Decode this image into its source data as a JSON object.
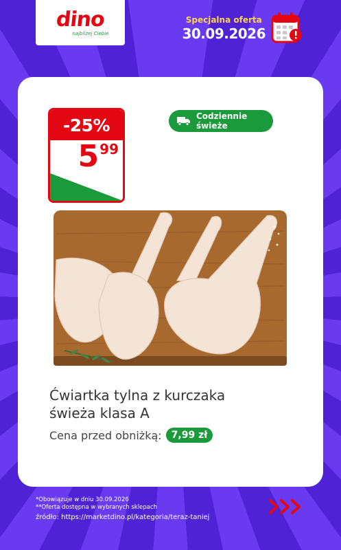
{
  "brand": {
    "logo_text": "dino",
    "tagline": "najbliżej Ciebie",
    "accent": "#e30613",
    "green": "#1a9a3a",
    "background": "#5b2be0"
  },
  "offer": {
    "label": "Specjalna oferta",
    "date": "30.09.2026",
    "icon": "calendar-alert-icon"
  },
  "badge": {
    "discount": "-25%",
    "price_int": "5",
    "price_dec": "99"
  },
  "fresh": {
    "label": "Codziennie świeże",
    "icon": "delivery-truck-icon"
  },
  "product": {
    "title_line1": "Ćwiartka tylna z kurczaka",
    "title_line2": "świeża klasa A",
    "prev_price_label": "Cena przed obniżką:",
    "prev_price_value": "7,99 zł",
    "image": "chicken-legs-on-cutting-board"
  },
  "footer": {
    "line1": "*Obowiązuje w dniu 30.09.2026",
    "line2": "**Oferta dostępna w wybranych sklepach",
    "source": "źródło: https://marketdino.pl/kategoria/teraz-taniej",
    "arrows_icon": "triple-chevron-right-icon"
  }
}
